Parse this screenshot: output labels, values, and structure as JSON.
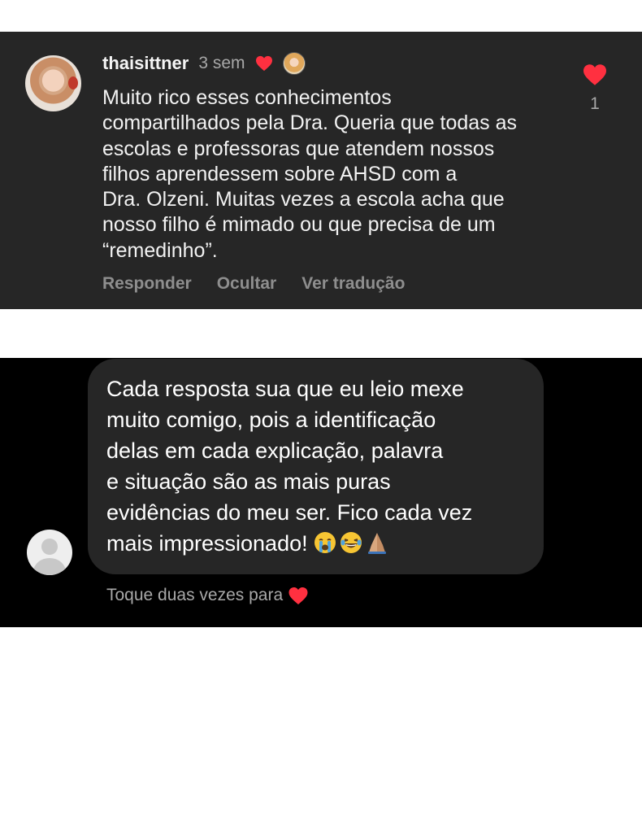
{
  "comment": {
    "username": "thaisittner",
    "time": "3 sem",
    "text_lines": [
      "Muito rico esses conhecimentos",
      "compartilhados pela Dra. Queria que todas as",
      "escolas e professoras que atendem nossos",
      "filhos aprendessem sobre AHSD com a",
      "Dra. Olzeni. Muitas vezes a escola acha que",
      "nosso filho é mimado ou que precisa de um",
      "“remedinho”."
    ],
    "actions": [
      "Responder",
      "Ocultar",
      "Ver tradução"
    ],
    "like_count": "1"
  },
  "message": {
    "text_lines": [
      "Cada resposta sua que eu leio mexe",
      "muito comigo, pois a identificação",
      "delas em cada explicação, palavra",
      "e situação são as mais puras",
      "evidências do meu ser.  Fico cada vez",
      "mais impressionado!"
    ],
    "emojis": [
      "crying-face",
      "laughing-face",
      "folded-hands"
    ],
    "hint": "Toque duas vezes para"
  },
  "colors": {
    "heart": "#ff3040",
    "card_bg": "#262626",
    "panel_bg": "#000000"
  }
}
